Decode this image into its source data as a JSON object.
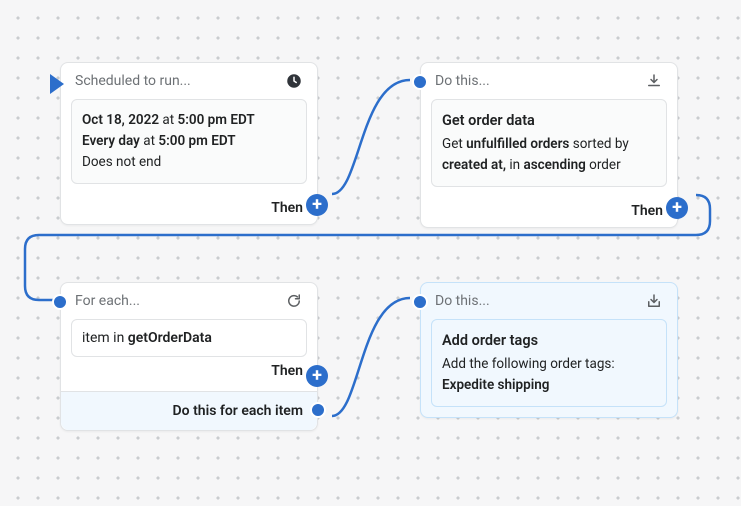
{
  "card1": {
    "headerLabel": "Scheduled to run...",
    "date": "Oct 18, 2022",
    "at1": " at ",
    "time1": "5:00 pm EDT",
    "every": "Every day",
    "at2": " at ",
    "time2": "5:00 pm EDT",
    "endText": "Does not end",
    "thenLabel": "Then"
  },
  "card2": {
    "headerLabel": "Do this...",
    "title": "Get order data",
    "line1a": "Get ",
    "line1b": "unfulfilled orders",
    "line1c": " sorted by ",
    "line2a": "created at,",
    "line2b": " in ",
    "line2c": "ascending",
    "line2d": " order",
    "thenLabel": "Then"
  },
  "card3": {
    "headerLabel": "For each...",
    "itemPrefix": "item in ",
    "itemBold": "getOrderData",
    "thenLabel": "Then",
    "doEachLabel": "Do this for each item"
  },
  "card4": {
    "headerLabel": "Do this...",
    "title": "Add order tags",
    "line1": "Add the following order tags:",
    "line2": "Expedite shipping"
  }
}
